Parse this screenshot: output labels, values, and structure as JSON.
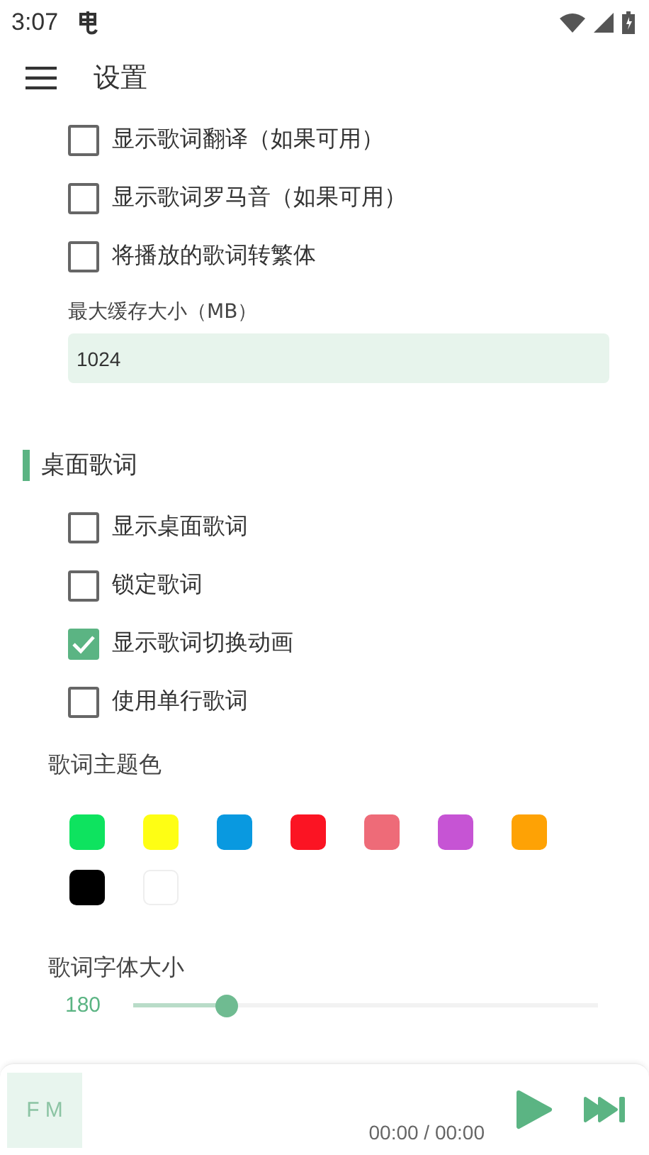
{
  "status_bar": {
    "time": "3:07"
  },
  "toolbar": {
    "title": "设置"
  },
  "lyrics_options": [
    {
      "label": "显示歌词翻译（如果可用）",
      "checked": false
    },
    {
      "label": "显示歌词罗马音（如果可用）",
      "checked": false
    },
    {
      "label": "将播放的歌词转繁体",
      "checked": false
    }
  ],
  "cache_field": {
    "label": "最大缓存大小（MB）",
    "value": "1024"
  },
  "section": {
    "title": "桌面歌词"
  },
  "desktop_options": [
    {
      "label": "显示桌面歌词",
      "checked": false
    },
    {
      "label": "锁定歌词",
      "checked": false
    },
    {
      "label": "显示歌词切换动画",
      "checked": true
    },
    {
      "label": "使用单行歌词",
      "checked": false
    }
  ],
  "theme_color": {
    "label": "歌词主题色",
    "colors": [
      {
        "color": "#0ee35f"
      },
      {
        "color": "#fefe14"
      },
      {
        "color": "#0999e0"
      },
      {
        "color": "#fb1423"
      },
      {
        "color": "#ee6b78"
      },
      {
        "color": "#c654d4"
      },
      {
        "color": "#fea205"
      },
      {
        "color": "#000000"
      },
      {
        "color": "#ffffff"
      }
    ]
  },
  "font_size": {
    "label": "歌词字体大小",
    "reading": "180",
    "level": 0.2
  },
  "player": {
    "cover": "F M",
    "time": "00:00 / 00:00"
  }
}
